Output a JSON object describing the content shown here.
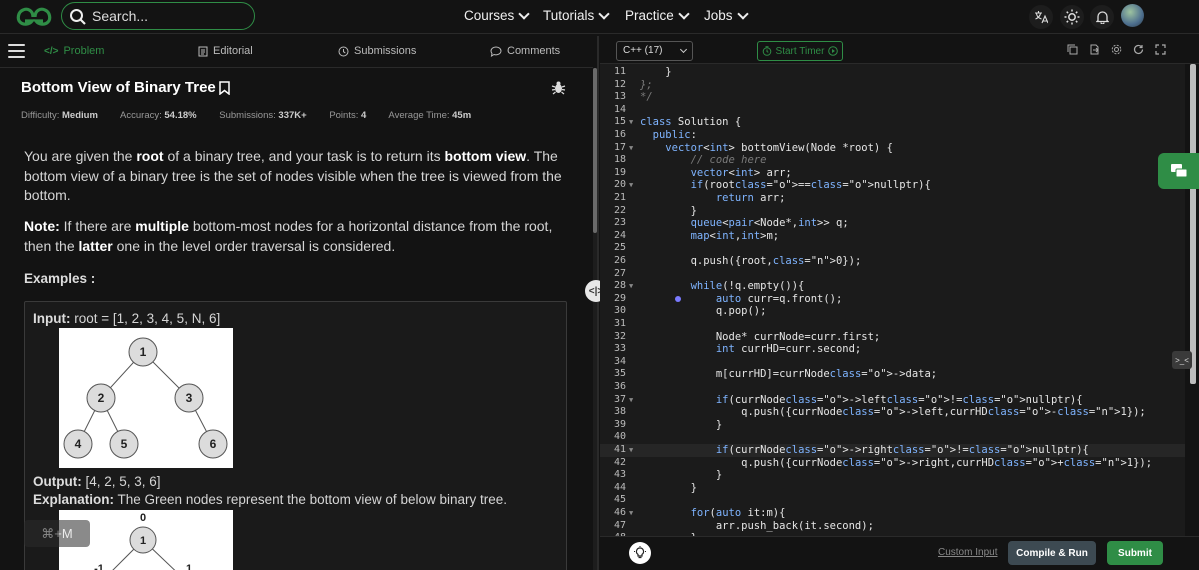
{
  "header": {
    "search_placeholder": "Search...",
    "nav": [
      "Courses",
      "Tutorials",
      "Practice",
      "Jobs"
    ]
  },
  "tabs": [
    "Problem",
    "Editorial",
    "Submissions",
    "Comments"
  ],
  "problem": {
    "title": "Bottom View of Binary Tree",
    "meta": {
      "difficulty_label": "Difficulty:",
      "difficulty": "Medium",
      "accuracy_label": "Accuracy:",
      "accuracy": "54.18%",
      "submissions_label": "Submissions:",
      "submissions": "337K+",
      "points_label": "Points:",
      "points": "4",
      "avg_time_label": "Average Time:",
      "avg_time": "45m"
    },
    "desc": {
      "p1a": "You are given the ",
      "p1b": "root",
      "p1c": " of a binary tree, and your task is to return its ",
      "p1d": "bottom view",
      "p1e": ". The bottom view of a binary tree is the set of nodes visible when the tree is viewed from the bottom.",
      "note_label": "Note:",
      "n1": " If there are ",
      "n2": "multiple",
      "n3": " bottom-most nodes for a horizontal distance from the root, then the ",
      "n4": "latter",
      "n5": " one in the level order traversal is considered."
    },
    "examples_label": "Examples :",
    "example": {
      "input_label": "Input:",
      "input": "root = [1, 2, 3, 4, 5, N, 6]",
      "output_label": "Output:",
      "output": "[4, 2, 5, 3, 6]",
      "explanation_label": "Explanation:",
      "explanation": "The Green nodes represent the bottom view of below binary tree.",
      "tree1_nodes": [
        "1",
        "2",
        "3",
        "4",
        "5",
        "6"
      ],
      "tree2_nodes": [
        "0",
        "1",
        "-1",
        "1"
      ]
    },
    "shortcut": "⌘+M"
  },
  "editor": {
    "language": "C++ (17)",
    "timer": "Start Timer",
    "lines": [
      {
        "n": "11",
        "t": "    }"
      },
      {
        "n": "12",
        "t": "};"
      },
      {
        "n": "13",
        "t": "*/"
      },
      {
        "n": "14",
        "t": ""
      },
      {
        "n": "15",
        "t": "class Solution {"
      },
      {
        "n": "16",
        "t": "  public:"
      },
      {
        "n": "17",
        "t": "    vector<int> bottomView(Node *root) {"
      },
      {
        "n": "18",
        "t": "        // code here"
      },
      {
        "n": "19",
        "t": "        vector<int> arr;"
      },
      {
        "n": "20",
        "t": "        if(root==nullptr){"
      },
      {
        "n": "21",
        "t": "            return arr;"
      },
      {
        "n": "22",
        "t": "        }"
      },
      {
        "n": "23",
        "t": "        queue<pair<Node*,int>> q;"
      },
      {
        "n": "24",
        "t": "        map<int,int>m;"
      },
      {
        "n": "25",
        "t": ""
      },
      {
        "n": "26",
        "t": "        q.push({root,0});"
      },
      {
        "n": "27",
        "t": ""
      },
      {
        "n": "28",
        "t": "        while(!q.empty()){"
      },
      {
        "n": "29",
        "t": "            auto curr=q.front();"
      },
      {
        "n": "30",
        "t": "            q.pop();"
      },
      {
        "n": "31",
        "t": ""
      },
      {
        "n": "32",
        "t": "            Node* currNode=curr.first;"
      },
      {
        "n": "33",
        "t": "            int currHD=curr.second;"
      },
      {
        "n": "34",
        "t": ""
      },
      {
        "n": "35",
        "t": "            m[currHD]=currNode->data;"
      },
      {
        "n": "36",
        "t": ""
      },
      {
        "n": "37",
        "t": "            if(currNode->left!=nullptr){"
      },
      {
        "n": "38",
        "t": "                q.push({currNode->left,currHD-1});"
      },
      {
        "n": "39",
        "t": "            }"
      },
      {
        "n": "40",
        "t": ""
      },
      {
        "n": "41",
        "t": "            if(currNode->right!=nullptr){"
      },
      {
        "n": "42",
        "t": "                q.push({currNode->right,currHD+1});"
      },
      {
        "n": "43",
        "t": "            }"
      },
      {
        "n": "44",
        "t": "        }"
      },
      {
        "n": "45",
        "t": ""
      },
      {
        "n": "46",
        "t": "        for(auto it:m){"
      },
      {
        "n": "47",
        "t": "            arr.push_back(it.second);"
      },
      {
        "n": "48",
        "t": "        }"
      }
    ],
    "custom_input": "Custom Input",
    "compile_run": "Compile & Run",
    "submit": "Submit"
  },
  "colors": {
    "brand": "#2f8d46",
    "background": "#131313",
    "editor_bg": "#1b1b1b"
  }
}
